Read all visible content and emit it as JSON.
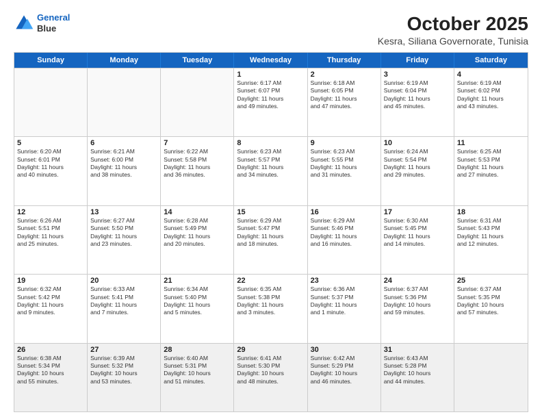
{
  "header": {
    "logo_line1": "General",
    "logo_line2": "Blue",
    "title": "October 2025",
    "subtitle": "Kesra, Siliana Governorate, Tunisia"
  },
  "weekdays": [
    "Sunday",
    "Monday",
    "Tuesday",
    "Wednesday",
    "Thursday",
    "Friday",
    "Saturday"
  ],
  "rows": [
    [
      {
        "day": "",
        "text": "",
        "empty": true
      },
      {
        "day": "",
        "text": "",
        "empty": true
      },
      {
        "day": "",
        "text": "",
        "empty": true
      },
      {
        "day": "1",
        "text": "Sunrise: 6:17 AM\nSunset: 6:07 PM\nDaylight: 11 hours\nand 49 minutes."
      },
      {
        "day": "2",
        "text": "Sunrise: 6:18 AM\nSunset: 6:05 PM\nDaylight: 11 hours\nand 47 minutes."
      },
      {
        "day": "3",
        "text": "Sunrise: 6:19 AM\nSunset: 6:04 PM\nDaylight: 11 hours\nand 45 minutes."
      },
      {
        "day": "4",
        "text": "Sunrise: 6:19 AM\nSunset: 6:02 PM\nDaylight: 11 hours\nand 43 minutes."
      }
    ],
    [
      {
        "day": "5",
        "text": "Sunrise: 6:20 AM\nSunset: 6:01 PM\nDaylight: 11 hours\nand 40 minutes."
      },
      {
        "day": "6",
        "text": "Sunrise: 6:21 AM\nSunset: 6:00 PM\nDaylight: 11 hours\nand 38 minutes."
      },
      {
        "day": "7",
        "text": "Sunrise: 6:22 AM\nSunset: 5:58 PM\nDaylight: 11 hours\nand 36 minutes."
      },
      {
        "day": "8",
        "text": "Sunrise: 6:23 AM\nSunset: 5:57 PM\nDaylight: 11 hours\nand 34 minutes."
      },
      {
        "day": "9",
        "text": "Sunrise: 6:23 AM\nSunset: 5:55 PM\nDaylight: 11 hours\nand 31 minutes."
      },
      {
        "day": "10",
        "text": "Sunrise: 6:24 AM\nSunset: 5:54 PM\nDaylight: 11 hours\nand 29 minutes."
      },
      {
        "day": "11",
        "text": "Sunrise: 6:25 AM\nSunset: 5:53 PM\nDaylight: 11 hours\nand 27 minutes."
      }
    ],
    [
      {
        "day": "12",
        "text": "Sunrise: 6:26 AM\nSunset: 5:51 PM\nDaylight: 11 hours\nand 25 minutes."
      },
      {
        "day": "13",
        "text": "Sunrise: 6:27 AM\nSunset: 5:50 PM\nDaylight: 11 hours\nand 23 minutes."
      },
      {
        "day": "14",
        "text": "Sunrise: 6:28 AM\nSunset: 5:49 PM\nDaylight: 11 hours\nand 20 minutes."
      },
      {
        "day": "15",
        "text": "Sunrise: 6:29 AM\nSunset: 5:47 PM\nDaylight: 11 hours\nand 18 minutes."
      },
      {
        "day": "16",
        "text": "Sunrise: 6:29 AM\nSunset: 5:46 PM\nDaylight: 11 hours\nand 16 minutes."
      },
      {
        "day": "17",
        "text": "Sunrise: 6:30 AM\nSunset: 5:45 PM\nDaylight: 11 hours\nand 14 minutes."
      },
      {
        "day": "18",
        "text": "Sunrise: 6:31 AM\nSunset: 5:43 PM\nDaylight: 11 hours\nand 12 minutes."
      }
    ],
    [
      {
        "day": "19",
        "text": "Sunrise: 6:32 AM\nSunset: 5:42 PM\nDaylight: 11 hours\nand 9 minutes."
      },
      {
        "day": "20",
        "text": "Sunrise: 6:33 AM\nSunset: 5:41 PM\nDaylight: 11 hours\nand 7 minutes."
      },
      {
        "day": "21",
        "text": "Sunrise: 6:34 AM\nSunset: 5:40 PM\nDaylight: 11 hours\nand 5 minutes."
      },
      {
        "day": "22",
        "text": "Sunrise: 6:35 AM\nSunset: 5:38 PM\nDaylight: 11 hours\nand 3 minutes."
      },
      {
        "day": "23",
        "text": "Sunrise: 6:36 AM\nSunset: 5:37 PM\nDaylight: 11 hours\nand 1 minute."
      },
      {
        "day": "24",
        "text": "Sunrise: 6:37 AM\nSunset: 5:36 PM\nDaylight: 10 hours\nand 59 minutes."
      },
      {
        "day": "25",
        "text": "Sunrise: 6:37 AM\nSunset: 5:35 PM\nDaylight: 10 hours\nand 57 minutes."
      }
    ],
    [
      {
        "day": "26",
        "text": "Sunrise: 6:38 AM\nSunset: 5:34 PM\nDaylight: 10 hours\nand 55 minutes."
      },
      {
        "day": "27",
        "text": "Sunrise: 6:39 AM\nSunset: 5:32 PM\nDaylight: 10 hours\nand 53 minutes."
      },
      {
        "day": "28",
        "text": "Sunrise: 6:40 AM\nSunset: 5:31 PM\nDaylight: 10 hours\nand 51 minutes."
      },
      {
        "day": "29",
        "text": "Sunrise: 6:41 AM\nSunset: 5:30 PM\nDaylight: 10 hours\nand 48 minutes."
      },
      {
        "day": "30",
        "text": "Sunrise: 6:42 AM\nSunset: 5:29 PM\nDaylight: 10 hours\nand 46 minutes."
      },
      {
        "day": "31",
        "text": "Sunrise: 6:43 AM\nSunset: 5:28 PM\nDaylight: 10 hours\nand 44 minutes."
      },
      {
        "day": "",
        "text": "",
        "empty": true
      }
    ]
  ]
}
